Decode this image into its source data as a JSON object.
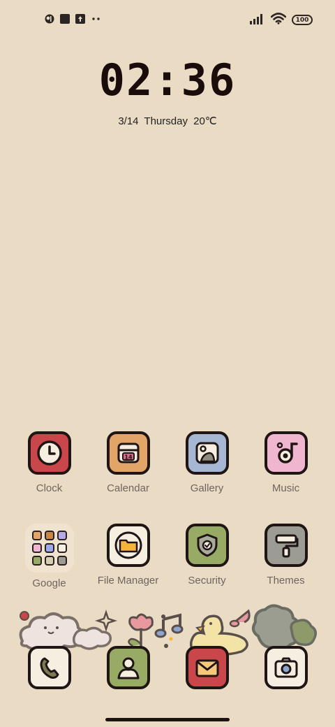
{
  "status_bar": {
    "left_icons": [
      "color-app-icon",
      "square-notification-icon",
      "upload-icon",
      "more-dots-icon"
    ],
    "right_icons": [
      "signal-icon",
      "wifi-icon"
    ],
    "battery_level": "100"
  },
  "clock_widget": {
    "time": "02:36",
    "date": "3/14  Thursday  20℃"
  },
  "apps_row1": [
    {
      "label": "Clock",
      "color": "#c9464a"
    },
    {
      "label": "Calendar",
      "color": "#e3a567"
    },
    {
      "label": "Gallery",
      "color": "#a5b7d2"
    },
    {
      "label": "Music",
      "color": "#f1b6cf"
    }
  ],
  "apps_row2": [
    {
      "label": "Google"
    },
    {
      "label": "File Manager",
      "color": "#f5eee1"
    },
    {
      "label": "Security",
      "color": "#98ab64"
    },
    {
      "label": "Themes",
      "color": "#9c9c92"
    }
  ],
  "dock": [
    {
      "name": "phone",
      "color": "#f5eee1"
    },
    {
      "name": "contacts",
      "color": "#98ab64"
    },
    {
      "name": "messages",
      "color": "#c9464a"
    },
    {
      "name": "camera",
      "color": "#f5eee1"
    }
  ]
}
